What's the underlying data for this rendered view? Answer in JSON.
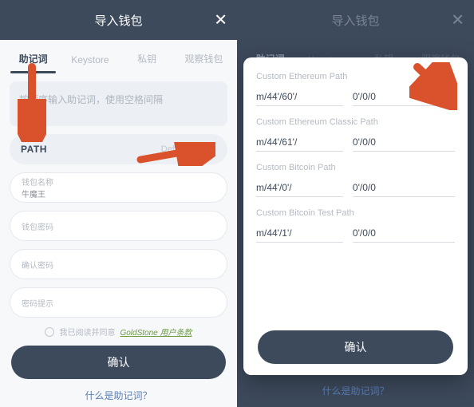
{
  "header_title": "导入钱包",
  "close_glyph": "✕",
  "tabs": {
    "t0": "助记词",
    "t1": "Keystore",
    "t2": "私钥",
    "t3": "观察钱包"
  },
  "left": {
    "mnemonic_placeholder": "按顺序输入助记词，使用空格间隔",
    "path_label": "PATH",
    "path_value": "Default Path",
    "wallet_name_label": "钱包名称",
    "wallet_name_value": "牛魔王",
    "wallet_password_label": "钱包密码",
    "confirm_password_label": "确认密码",
    "password_hint_label": "密码提示",
    "terms_prefix": "我已阅读并同意",
    "terms_link": "GoldStone 用户条款",
    "confirm": "确认",
    "footer": "什么是助记词？"
  },
  "right": {
    "paths": [
      {
        "title": "Custom Ethereum Path",
        "prefix": "m/44'/60'/",
        "suffix": "0'/0/0"
      },
      {
        "title": "Custom Ethereum Classic Path",
        "prefix": "m/44'/61'/",
        "suffix": "0'/0/0"
      },
      {
        "title": "Custom Bitcoin Path",
        "prefix": "m/44'/0'/",
        "suffix": "0'/0/0"
      },
      {
        "title": "Custom Bitcoin Test Path",
        "prefix": "m/44'/1'/",
        "suffix": "0'/0/0"
      }
    ],
    "confirm": "确认",
    "dim_confirm": "确认",
    "footer": "什么是助记词？"
  }
}
